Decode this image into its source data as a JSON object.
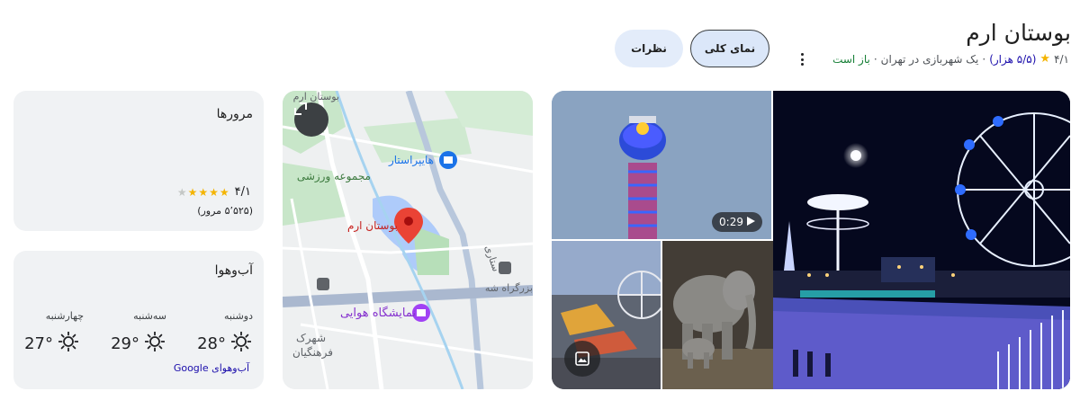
{
  "place": {
    "title": "بوستان ارم",
    "rating": "۴/۱",
    "review_count": "(۵/۵ هزار)",
    "category": "یک شهربازی در تهران",
    "status": "باز است",
    "more_icon": "more-vert-icon"
  },
  "tabs": {
    "overview": "نمای کلی",
    "reviews": "نظرات"
  },
  "photos": {
    "video_duration": "0:29",
    "play_icon": "play-icon",
    "gallery_icon": "image-icon"
  },
  "map": {
    "expand_icon": "expand-icon",
    "pin_label": "بوستان ارم",
    "labels": {
      "hyperstar": "هایپراستار",
      "sport_complex": "مجموعه ورزشی",
      "exhibition": "نمایشگاه هوایی",
      "town": "شهرک",
      "culture": "فرهنگیان",
      "highway": "بزرگراه شه",
      "road": "ستاری",
      "top_road": "بوستان ارم"
    }
  },
  "reviews_card": {
    "title": "مرورها",
    "rating": "۴/۱",
    "stars_filled": 4,
    "stars_total": 5,
    "count": "(۵٬۵۲۵ مرور)"
  },
  "weather_card": {
    "title": "آب‌وهوا",
    "days": [
      {
        "name": "دوشنبه",
        "temp": "28°",
        "icon": "sun-icon"
      },
      {
        "name": "سه‌شنبه",
        "temp": "29°",
        "icon": "sun-icon"
      },
      {
        "name": "چهارشنبه",
        "temp": "27°",
        "icon": "sun-icon"
      }
    ],
    "source": "آب‌وهوای Google"
  },
  "colors": {
    "star": "#f4b400",
    "link": "#1a0dab",
    "open": "#188038",
    "map_pin": "#ea4335",
    "map_poi_blue": "#1a73e8",
    "map_poi_purple": "#a142f4"
  }
}
